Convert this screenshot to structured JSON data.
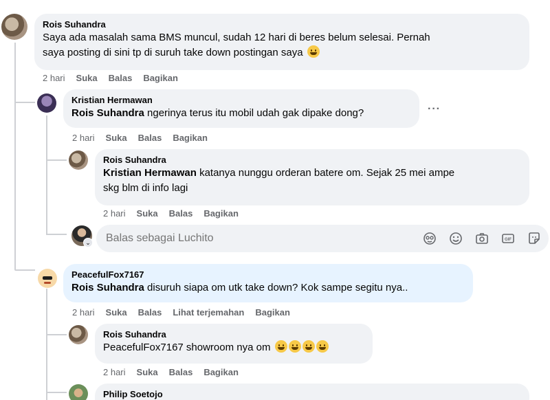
{
  "comments": [
    {
      "author": "Rois Suhandra",
      "lines": [
        "Saya ada masalah sama BMS muncul, sudah 12 hari di beres belum selesai. Pernah",
        "saya posting di sini tp di suruh take down postingan saya"
      ],
      "time": "2 hari",
      "like": "Suka",
      "reply": "Balas",
      "share": "Bagikan"
    },
    {
      "author": "Kristian Hermawan",
      "mention": "Rois Suhandra",
      "text": "ngerinya terus itu mobil udah gak dipake dong?",
      "time": "2 hari",
      "like": "Suka",
      "reply": "Balas",
      "share": "Bagikan",
      "more": "···"
    },
    {
      "author": "Rois Suhandra",
      "mention": "Kristian Hermawan",
      "line1": "katanya nunggu orderan batere om. Sejak 25 mei ampe",
      "line2": "skg blm di info lagi",
      "time": "2 hari",
      "like": "Suka",
      "reply": "Balas",
      "share": "Bagikan"
    },
    {
      "author": "PeacefulFox7167",
      "mention": "Rois Suhandra",
      "text": "disuruh siapa om utk take down? Kok sampe segitu nya..",
      "time": "2 hari",
      "like": "Suka",
      "reply": "Balas",
      "translate": "Lihat terjemahan",
      "share": "Bagikan"
    },
    {
      "author": "Rois Suhandra",
      "text": "PeacefulFox7167 showroom nya om",
      "time": "2 hari",
      "like": "Suka",
      "reply": "Balas",
      "share": "Bagikan"
    },
    {
      "author": "Philip Soetojo"
    }
  ],
  "reply_box": {
    "placeholder": "Balas sebagai Luchito",
    "icons": [
      "avatar-sticker-icon",
      "emoji-icon",
      "camera-icon",
      "gif-icon",
      "sticker-icon"
    ]
  },
  "colors": {
    "bubble": "#f0f2f5",
    "bubble_highlight": "#e7f3ff",
    "meta_text": "#65676b",
    "thread_line": "#ced0d4"
  }
}
